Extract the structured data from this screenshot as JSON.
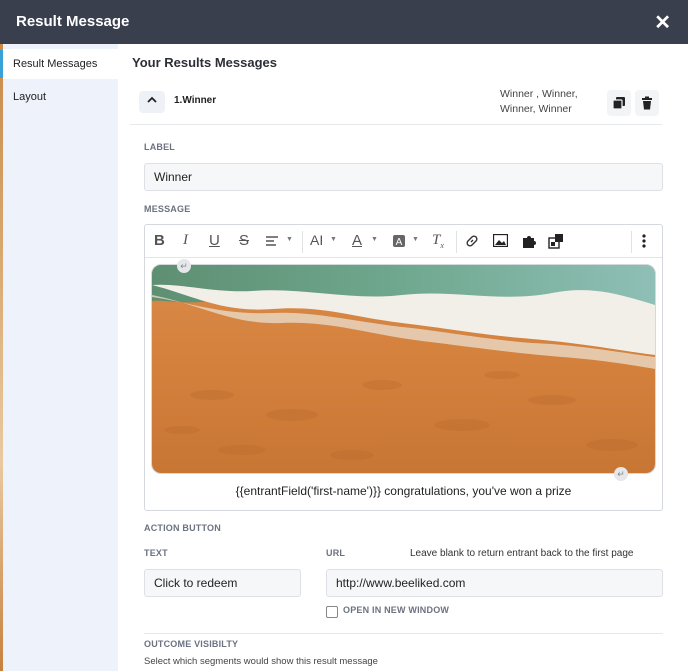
{
  "header": {
    "title": "Result Message",
    "close_glyph": "✕"
  },
  "sidebar": {
    "items": [
      {
        "label": "Result Messages"
      },
      {
        "label": "Layout"
      }
    ]
  },
  "main": {
    "section_title": "Your Results Messages",
    "row": {
      "toggle_glyph": "⌃",
      "name": "1.Winner",
      "tags_line1": "Winner , Winner,",
      "tags_line2": "Winner, Winner"
    },
    "label_field": {
      "label": "LABEL",
      "value": "Winner"
    },
    "message": {
      "label": "MESSAGE",
      "caption": "{{entrantField('first-name')}} congratulations, you've won a prize"
    },
    "action_button": {
      "section_label": "ACTION BUTTON",
      "text_label": "TEXT",
      "text_value": "Click to redeem",
      "url_label": "URL",
      "url_hint": "Leave blank to return entrant back to the first page",
      "url_value": "http://www.beeliked.com",
      "new_window_label": "OPEN IN NEW WINDOW"
    },
    "outcome": {
      "label": "OUTCOME VISIBILTY",
      "description": "Select which segments would show this result message"
    }
  },
  "toolbar": {
    "icons": [
      "bold-icon",
      "italic-icon",
      "underline-icon",
      "strikethrough-icon",
      "align-icon",
      "font-size-icon",
      "font-color-icon",
      "background-color-icon",
      "clear-format-icon",
      "link-icon",
      "image-icon",
      "plugin-icon",
      "embed-icon",
      "more-icon"
    ]
  },
  "colors": {
    "header_bg": "#3a3f4d",
    "sidebar_bg": "#eef3fb",
    "input_bg": "#f6f7f9",
    "accent": "#3aa0d8"
  }
}
